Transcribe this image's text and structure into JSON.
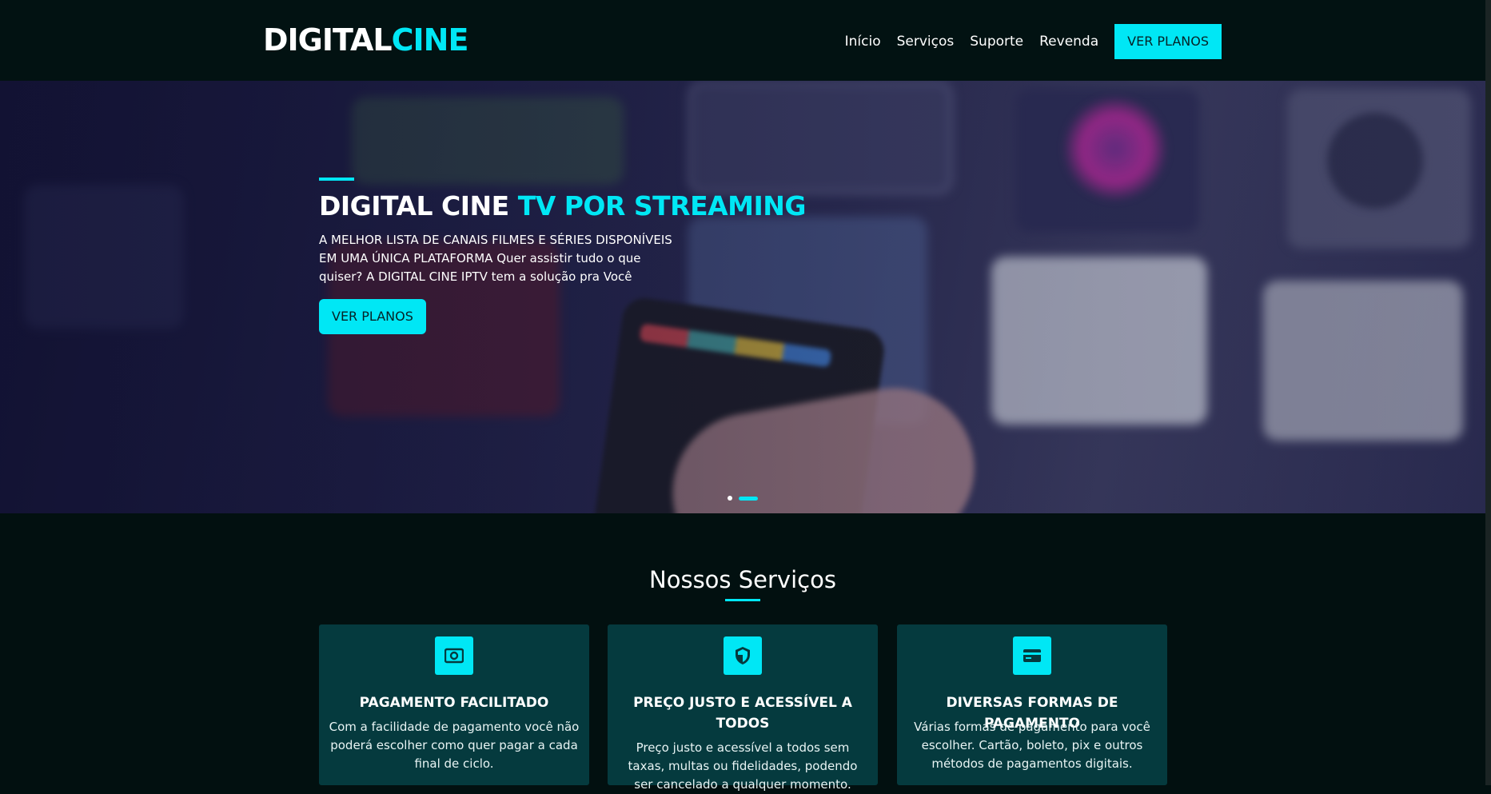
{
  "header": {
    "logo_part1": "DIGITAL",
    "logo_part2": "CINE",
    "nav": [
      "Início",
      "Serviços",
      "Suporte",
      "Revenda"
    ],
    "cta_label": "VER PLANOS"
  },
  "hero": {
    "title_part1": "DIGITAL CINE",
    "title_part2": "TV POR STREAMING",
    "description": "A MELHOR LISTA DE CANAIS FILMES E SÉRIES DISPONÍVEIS EM UMA ÚNICA PLATAFORMA Quer assistir tudo o que quiser? A DIGITAL CINE IPTV tem a solução pra Você",
    "button_label": "VER PLANOS",
    "slides_count": 2,
    "active_slide": 2
  },
  "services": {
    "title": "Nossos Serviços",
    "cards": [
      {
        "icon": "money-icon",
        "title": "PAGAMENTO FACILITADO",
        "description": "Com a facilidade de pagamento você não poderá escolher como quer pagar a cada final de ciclo."
      },
      {
        "icon": "shield-icon",
        "title": "PREÇO JUSTO E ACESSÍVEL A TODOS",
        "description": "Preço justo e acessível a todos sem taxas, multas ou fidelidades, podendo ser cancelado a qualquer momento."
      },
      {
        "icon": "credit-card-icon",
        "title": "DIVERSAS FORMAS DE PAGAMENTO",
        "description": "Várias formas de pagamento para você escolher. Cartão, boleto, pix e outros métodos de pagamentos digitais."
      }
    ]
  },
  "colors": {
    "accent": "#00e7f5",
    "background": "#021010",
    "card": "#053a3e"
  }
}
